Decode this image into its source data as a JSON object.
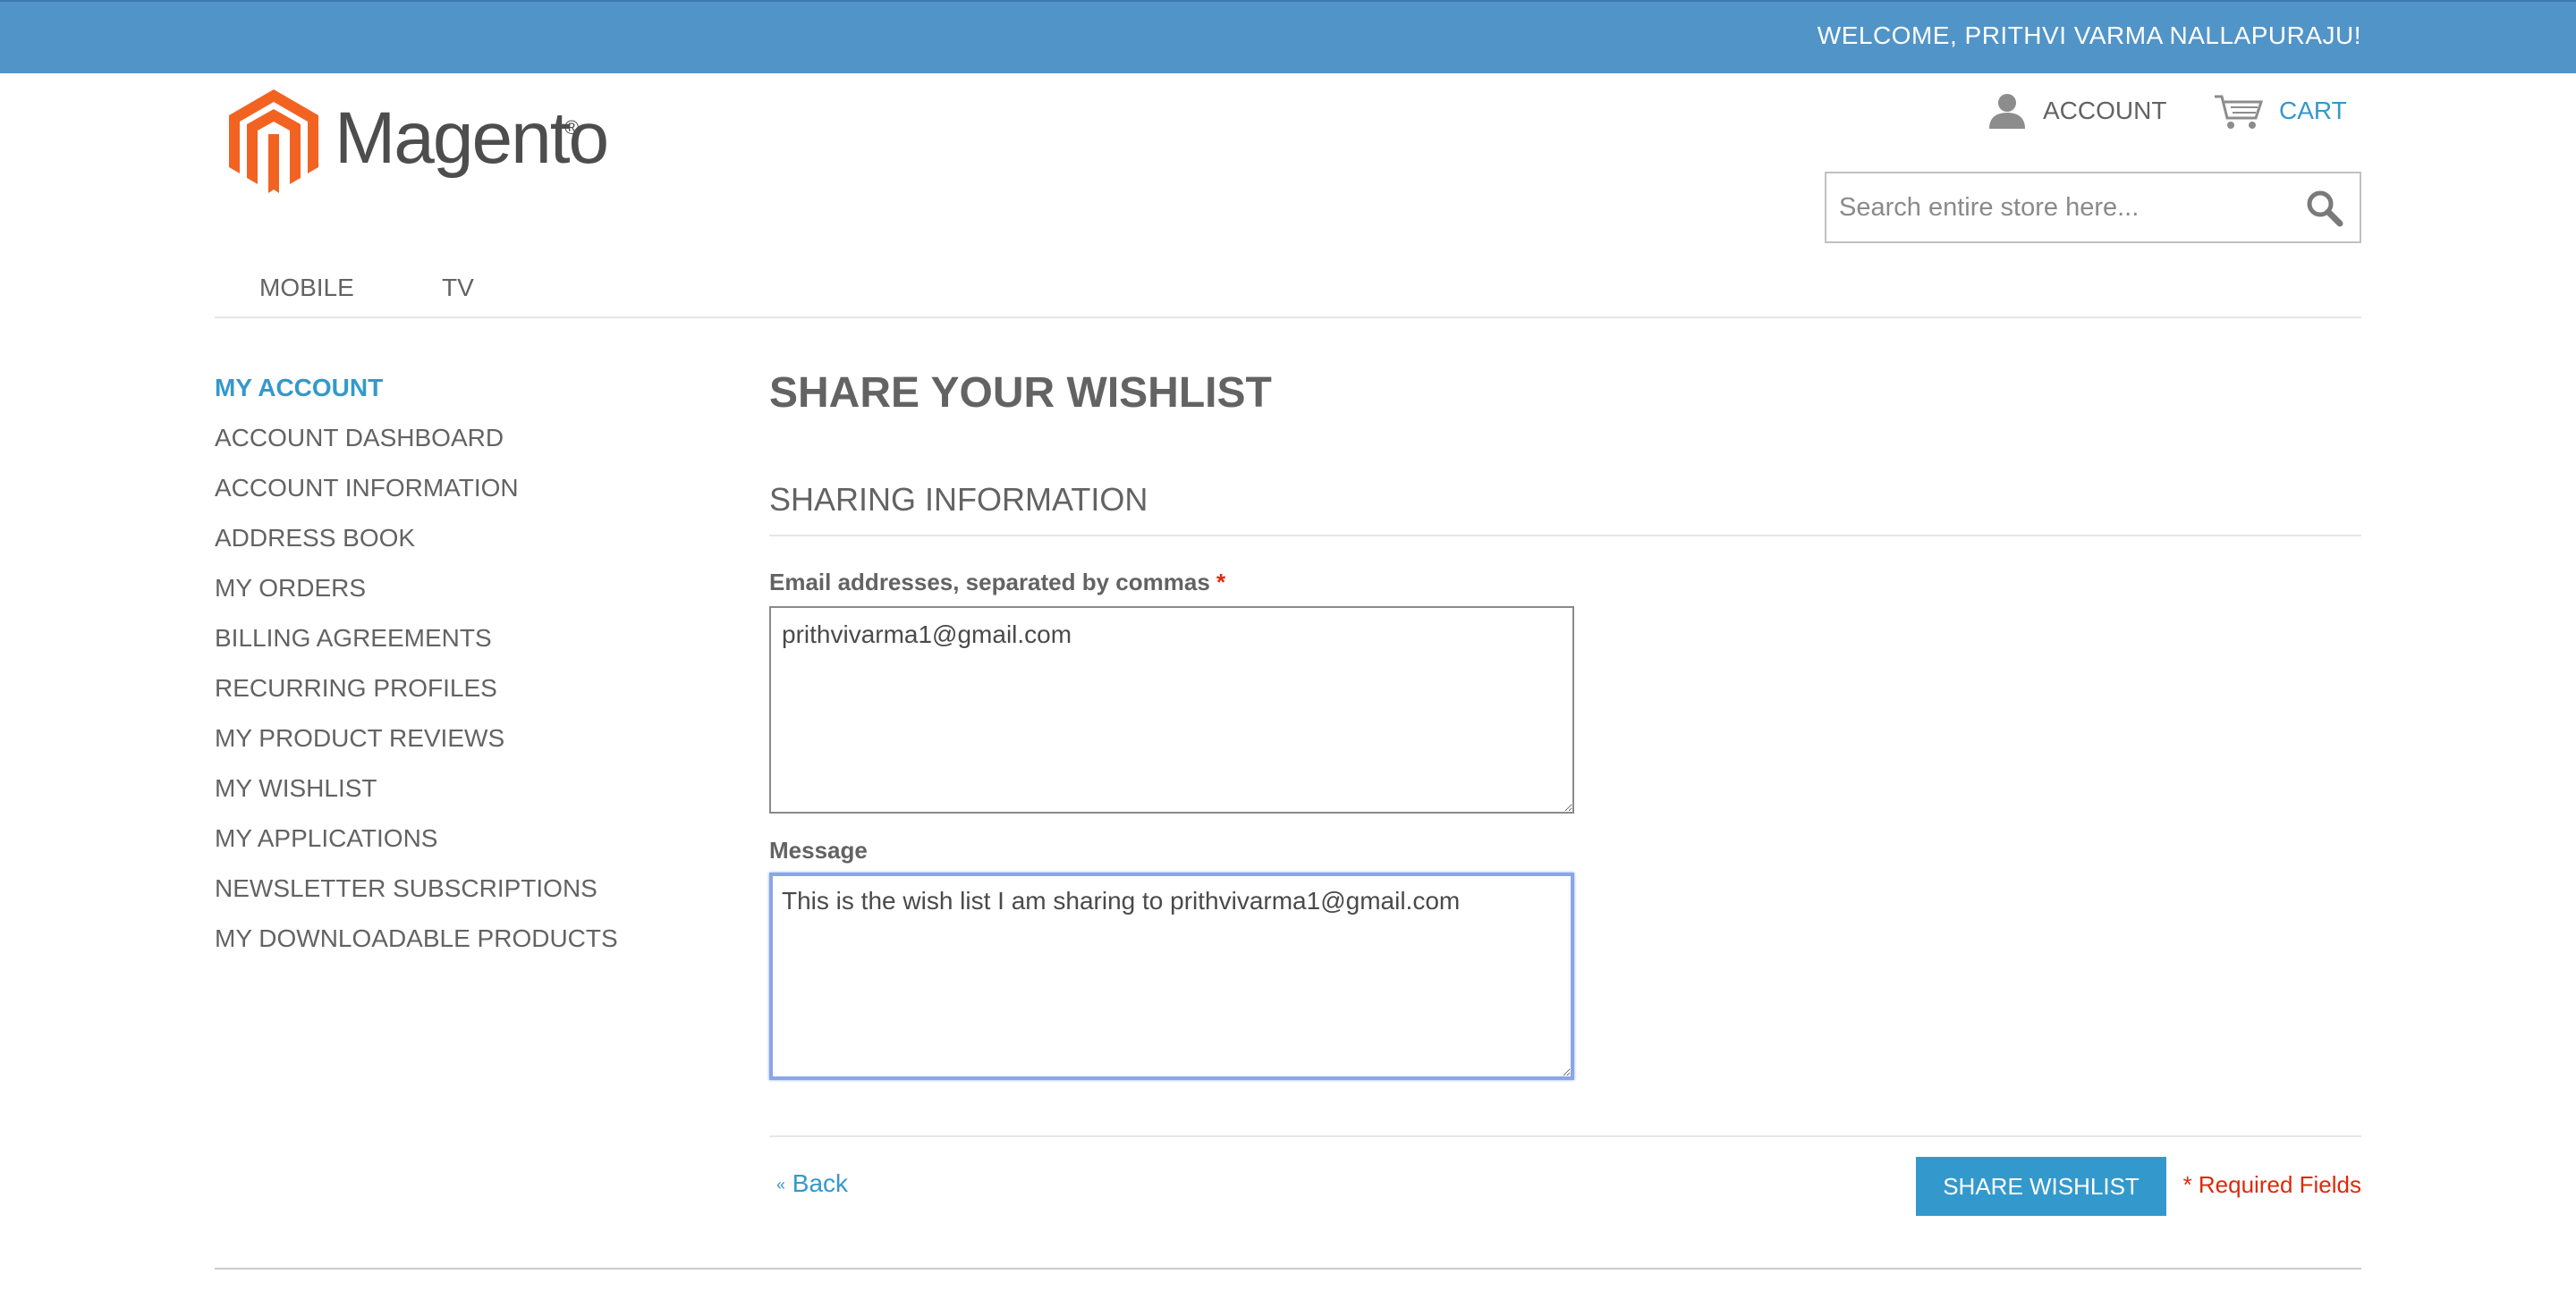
{
  "header": {
    "welcome": "WELCOME, PRITHVI VARMA NALLAPURAJU!",
    "logo_text": "Magento",
    "logo_reg": "®",
    "account_label": "ACCOUNT",
    "cart_label": "CART",
    "search_placeholder": "Search entire store here...",
    "icons": {
      "account": "user-icon",
      "cart": "cart-icon",
      "search": "search-icon"
    }
  },
  "nav": {
    "items": [
      "MOBILE",
      "TV"
    ]
  },
  "sidebar": {
    "title": "MY ACCOUNT",
    "items": [
      "ACCOUNT DASHBOARD",
      "ACCOUNT INFORMATION",
      "ADDRESS BOOK",
      "MY ORDERS",
      "BILLING AGREEMENTS",
      "RECURRING PROFILES",
      "MY PRODUCT REVIEWS",
      "MY WISHLIST",
      "MY APPLICATIONS",
      "NEWSLETTER SUBSCRIPTIONS",
      "MY DOWNLOADABLE PRODUCTS"
    ]
  },
  "main": {
    "page_title": "SHARE YOUR WISHLIST",
    "section_title": "SHARING INFORMATION",
    "email_label": "Email addresses, separated by commas",
    "email_required": "*",
    "email_value": "prithvivarma1@gmail.com",
    "message_label": "Message",
    "message_value": "This is the wish list I am sharing to prithvivarma1@gmail.com",
    "back_prefix": "«",
    "back_label": "Back",
    "share_button": "SHARE WISHLIST",
    "required_note": "* Required Fields"
  },
  "colors": {
    "topbar": "#5194c8",
    "accent": "#3399cc",
    "required": "#df280a",
    "logo_orange": "#f26322"
  }
}
